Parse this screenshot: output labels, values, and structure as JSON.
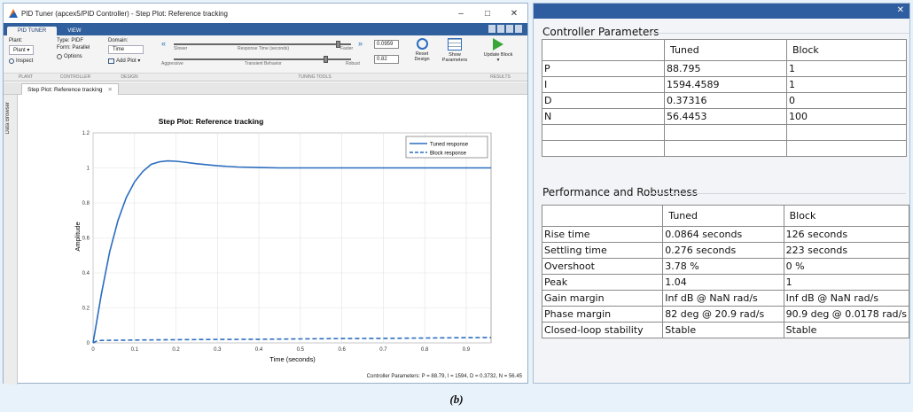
{
  "left_window": {
    "title": "PID Tuner (apcex5/PID Controller) - Step Plot: Reference tracking",
    "tabs": [
      "PID TUNER",
      "VIEW"
    ],
    "ribbon": {
      "plant_label": "Plant:",
      "plant_value": "Plant ▾",
      "inspect_label": "Inspect",
      "type_label": "Type: PIDF",
      "form_label": "Form: Parallel",
      "options_label": "Options",
      "domain_label": "Domain:",
      "domain_value": "Time",
      "add_plot_label": "Add Plot ▾",
      "slower_label": "Slower",
      "faster_label": "Faster",
      "response_time_label": "Response Time (seconds)",
      "aggressive_label": "Aggressive",
      "robust_label": "Robust",
      "transient_label": "Transient Behavior",
      "response_time_value": "0.0959",
      "transient_value": "0.82",
      "reset_label": "Reset Design",
      "show_params_label": "Show Parameters",
      "update_label": "Update Block ▾",
      "group_labels": [
        "PLANT",
        "CONTROLLER",
        "DESIGN",
        "TUNING TOOLS",
        "RESULTS"
      ],
      "response_time_slider_fraction": 0.93,
      "transient_slider_fraction": 0.86
    },
    "doc_tab_label": "Step Plot: Reference tracking",
    "data_browser_label": "Data Browser",
    "footer": "Controller Parameters: P = 88.79, I = 1594, D = 0.3732, N = 56.45"
  },
  "chart_data": {
    "type": "line",
    "title": "Step Plot: Reference tracking",
    "xlabel": "Time (seconds)",
    "ylabel": "Amplitude",
    "xlim": [
      0,
      0.96
    ],
    "ylim": [
      0,
      1.2
    ],
    "xticks": [
      "0",
      "0.1",
      "0.2",
      "0.3",
      "0.4",
      "0.5",
      "0.6",
      "0.7",
      "0.8",
      "0.9"
    ],
    "yticks": [
      "0",
      "0.2",
      "0.4",
      "0.6",
      "0.8",
      "1",
      "1.2"
    ],
    "legend_position": "top-right",
    "series": [
      {
        "name": "Tuned response",
        "style": "solid",
        "color": "#2b6dbf",
        "x": [
          0,
          0.02,
          0.04,
          0.06,
          0.08,
          0.1,
          0.12,
          0.14,
          0.16,
          0.18,
          0.2,
          0.22,
          0.25,
          0.3,
          0.35,
          0.4,
          0.45,
          0.5,
          0.6,
          0.7,
          0.8,
          0.9,
          0.96
        ],
        "y": [
          0,
          0.28,
          0.52,
          0.7,
          0.83,
          0.92,
          0.98,
          1.02,
          1.035,
          1.04,
          1.038,
          1.033,
          1.024,
          1.012,
          1.005,
          1.002,
          1.0,
          1.0,
          1.0,
          1.0,
          1.0,
          1.0,
          1.0
        ]
      },
      {
        "name": "Block response",
        "style": "dashed",
        "color": "#2b6dbf",
        "x": [
          0,
          0.01,
          0.02,
          0.1,
          0.2,
          0.3,
          0.4,
          0.5,
          0.6,
          0.7,
          0.8,
          0.9,
          0.96
        ],
        "y": [
          0,
          0.012,
          0.014,
          0.016,
          0.018,
          0.02,
          0.021,
          0.023,
          0.025,
          0.026,
          0.028,
          0.03,
          0.031
        ]
      }
    ]
  },
  "right_window": {
    "controller_section_title": "Controller Parameters",
    "controller_table": {
      "headers": [
        "",
        "Tuned",
        "Block"
      ],
      "rows": [
        [
          "P",
          "88.795",
          "1"
        ],
        [
          "I",
          "1594.4589",
          "1"
        ],
        [
          "D",
          "0.37316",
          "0"
        ],
        [
          "N",
          "56.4453",
          "100"
        ],
        [
          "",
          "",
          ""
        ],
        [
          "",
          "",
          ""
        ]
      ]
    },
    "performance_section_title": "Performance and Robustness",
    "performance_table": {
      "headers": [
        "",
        "Tuned",
        "Block"
      ],
      "rows": [
        [
          "Rise time",
          "0.0864 seconds",
          "126 seconds"
        ],
        [
          "Settling time",
          "0.276 seconds",
          "223 seconds"
        ],
        [
          "Overshoot",
          "3.78 %",
          "0 %"
        ],
        [
          "Peak",
          "1.04",
          "1"
        ],
        [
          "Gain margin",
          "Inf dB @ NaN rad/s",
          "Inf dB @ NaN rad/s"
        ],
        [
          "Phase margin",
          "82 deg @ 20.9 rad/s",
          "90.9 deg @ 0.0178 rad/s"
        ],
        [
          "Closed-loop stability",
          "Stable",
          "Stable"
        ]
      ]
    }
  },
  "caption": "(b)"
}
